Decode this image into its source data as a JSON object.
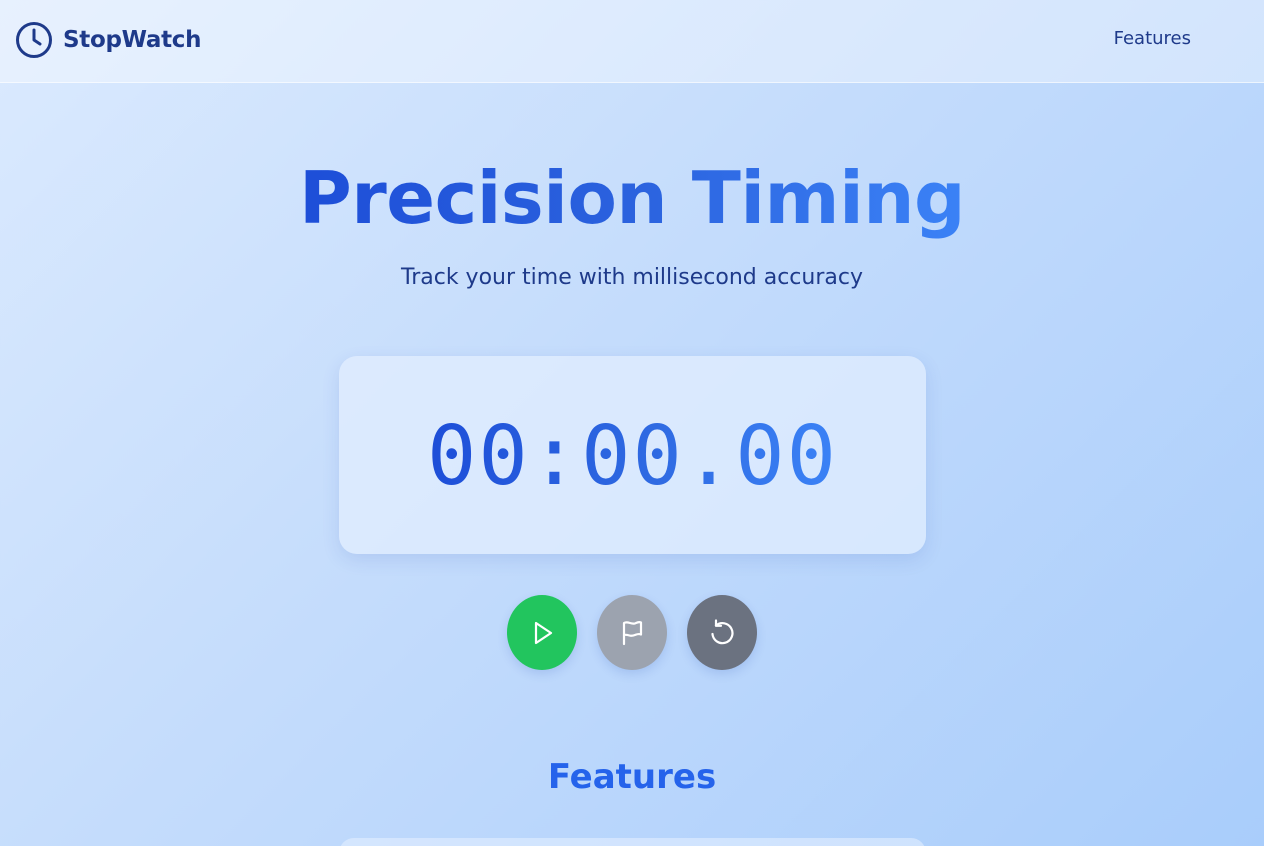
{
  "nav": {
    "brand": "StopWatch",
    "brand_icon": "clock-icon",
    "links": [
      "Features"
    ]
  },
  "hero": {
    "title": "Precision Timing",
    "subtitle": "Track your time with millisecond accuracy"
  },
  "timer": {
    "display": "00:00.00"
  },
  "controls": {
    "start_icon": "play-icon",
    "lap_icon": "flag-icon",
    "reset_icon": "reset-icon"
  },
  "features": {
    "heading": "Features"
  },
  "colors": {
    "brand_dark": "#1e3a8a",
    "accent_blue": "#2563eb",
    "start_green": "#22c55e",
    "lap_gray": "#9ca3af",
    "reset_gray": "#6b7280"
  }
}
